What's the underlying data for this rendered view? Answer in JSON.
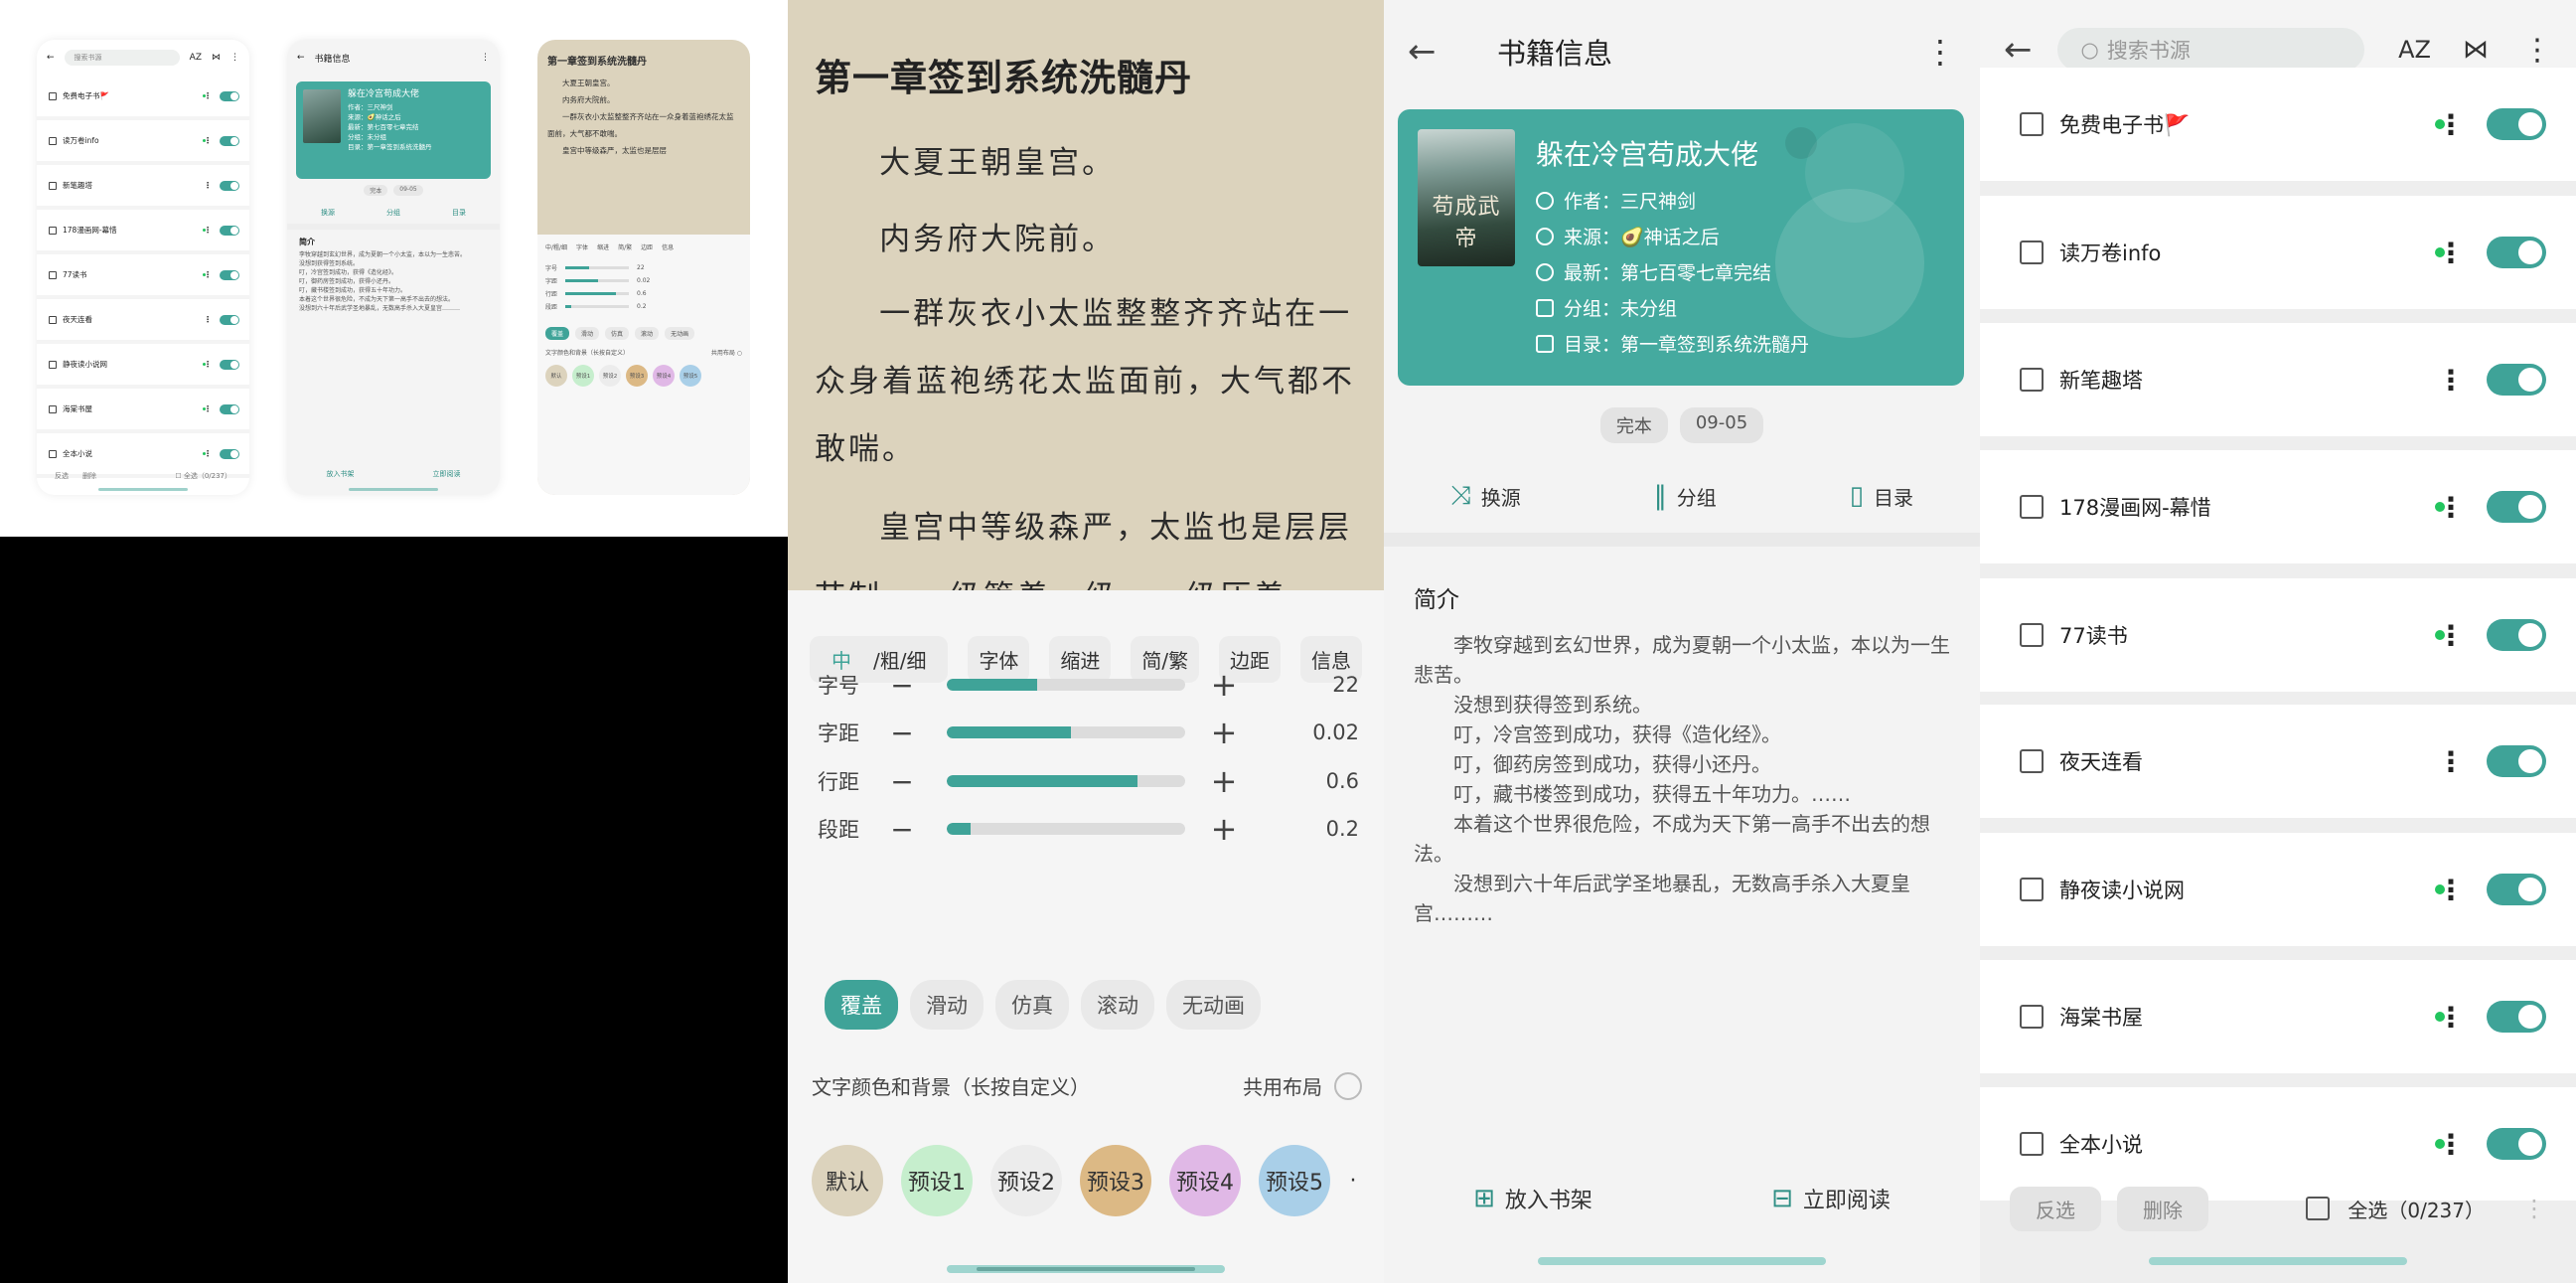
{
  "reader": {
    "chapter_title": "第一章签到系统洗髓丹",
    "paragraphs": [
      "大夏王朝皇宫。",
      "内务府大院前。",
      "一群灰衣小太监整整齐齐站在一众身着蓝袍绣花太监面前，大气都不敢喘。",
      "皇宫中等级森严，太监也是层层"
    ],
    "cut_line": "节制，一级管着一级，一级压着",
    "tabs": [
      {
        "pre": "中",
        "post": "/粗/细"
      },
      {
        "label": "字体"
      },
      {
        "label": "缩进"
      },
      {
        "label": "简/繁"
      },
      {
        "label": "边距"
      },
      {
        "label": "信息"
      }
    ],
    "sliders": [
      {
        "label": "字号",
        "value": "22",
        "fill": 0.38
      },
      {
        "label": "字距",
        "value": "0.02",
        "fill": 0.52
      },
      {
        "label": "行距",
        "value": "0.6",
        "fill": 0.8
      },
      {
        "label": "段距",
        "value": "0.2",
        "fill": 0.1
      }
    ],
    "minus_glyph": "−",
    "plus_glyph": "+",
    "page_modes": [
      "覆盖",
      "滑动",
      "仿真",
      "滚动",
      "无动画"
    ],
    "page_mode_selected": "覆盖",
    "color_label": "文字颜色和背景（长按自定义）",
    "share_layout_label": "共用布局",
    "presets": [
      {
        "label": "默认",
        "color": "#dcd3bd"
      },
      {
        "label": "预设1",
        "color": "#c6eecd"
      },
      {
        "label": "预设2",
        "color": "#ececec"
      },
      {
        "label": "预设3",
        "color": "#dcb985"
      },
      {
        "label": "预设4",
        "color": "#e0b8e6"
      },
      {
        "label": "预设5",
        "color": "#a9cfe8"
      }
    ]
  },
  "info": {
    "title": "书籍信息",
    "book_name": "躲在冷宫苟成大佬",
    "cover_text": "苟成武帝",
    "author": "作者：三尺神剑",
    "source": "来源：🥑神话之后",
    "latest": "最新：第七百零七章完结",
    "group": "分组：未分组",
    "toc": "目录：第一章签到系统洗髓丹",
    "chips": [
      "完本",
      "09-05"
    ],
    "actions": [
      "换源",
      "分组",
      "目录"
    ],
    "intro_title": "简介",
    "intro_lines": [
      "李牧穿越到玄幻世界，成为夏朝一个小太监，本以为一生悲苦。",
      "没想到获得签到系统。",
      "叮，冷宫签到成功，获得《造化经》。",
      "叮，御药房签到成功，获得小还丹。",
      "叮，藏书楼签到成功，获得五十年功力。……",
      "本着这个世界很危险，不成为天下第一高手不出去的想法。",
      "没想到六十年后武学圣地暴乱，无数高手杀入大夏皇宫………"
    ],
    "bottom": [
      "放入书架",
      "立即阅读"
    ]
  },
  "sources": {
    "search_placeholder": "搜索书源",
    "sort_label": "AZ",
    "rows": [
      {
        "name": "免费电子书🚩",
        "dot": true
      },
      {
        "name": "读万卷info",
        "dot": true
      },
      {
        "name": "新笔趣塔",
        "dot": false
      },
      {
        "name": "178漫画网-幕惜",
        "dot": true
      },
      {
        "name": "77读书",
        "dot": true
      },
      {
        "name": "夜天连看",
        "dot": false
      },
      {
        "name": "静夜读小说网",
        "dot": true
      },
      {
        "name": "海棠书屋",
        "dot": true
      },
      {
        "name": "全本小说",
        "dot": true
      }
    ],
    "invert_label": "反选",
    "delete_label": "删除",
    "select_all_label": "全选（0/237）"
  },
  "thumbs": {
    "t1_search": "搜索书源",
    "t2_title": "书籍信息",
    "t2_intro_title": "简介",
    "t3_title": "第一章签到系统洗髓丹"
  },
  "colors": {
    "accent": "#3fa398",
    "card": "#45aa9f",
    "paper": "#dcd3bd"
  }
}
